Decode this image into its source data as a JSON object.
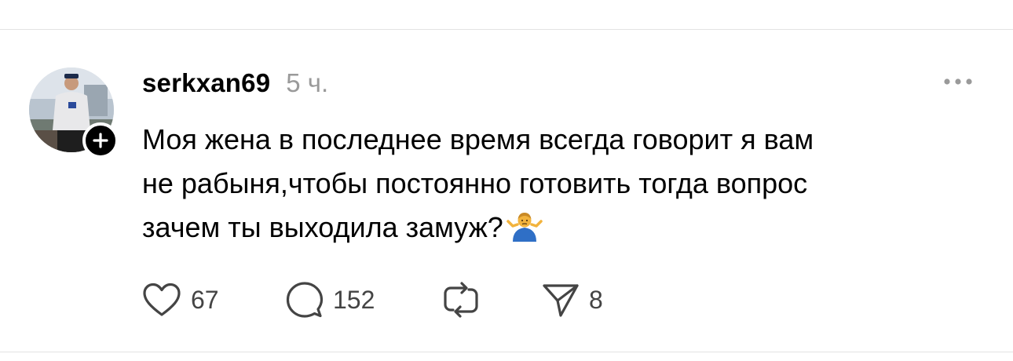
{
  "post": {
    "username": "serkxan69",
    "timestamp": "5 ч.",
    "text_lines": [
      "Моя жена в последнее время всегда говорит я вам",
      "не рабыня,чтобы постоянно готовить тогда вопрос",
      "зачем ты выходила замуж?"
    ],
    "emoji": "man-shrugging-emoji"
  },
  "actions": {
    "like_count": "67",
    "comment_count": "152",
    "repost_count": "",
    "share_count": "8"
  },
  "icons": {
    "like": "heart-icon",
    "comment": "speech-bubble-icon",
    "repost": "repost-arrows-icon",
    "share": "send-icon",
    "more": "more-dots-icon",
    "follow": "plus-icon"
  },
  "colors": {
    "text": "#000000",
    "muted": "#9a9a9a",
    "icon": "#444444",
    "divider": "#e3e3e3",
    "follow_badge": "#000000"
  }
}
